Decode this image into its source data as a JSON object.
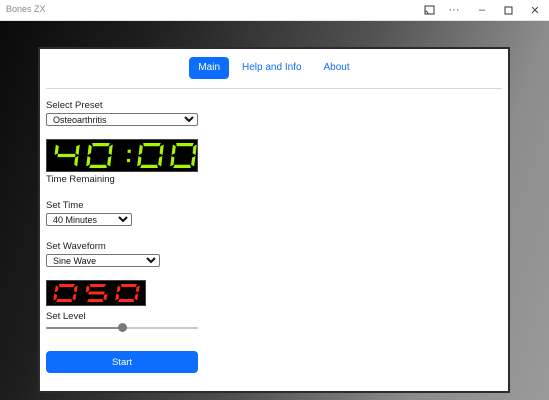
{
  "window": {
    "title": "Bones ZX",
    "controls": [
      "cast-icon",
      "more-icon",
      "minimize-icon",
      "maximize-icon",
      "close-icon"
    ]
  },
  "nav": {
    "items": [
      {
        "label": "Main",
        "active": true
      },
      {
        "label": "Help and Info",
        "active": false
      },
      {
        "label": "About",
        "active": false
      }
    ]
  },
  "preset": {
    "label": "Select Preset",
    "value": "Osteoarthritis"
  },
  "timer": {
    "display": "40:00",
    "caption": "Time Remaining",
    "color": "#a7f500"
  },
  "time": {
    "label": "Set Time",
    "value": "40 Minutes"
  },
  "waveform": {
    "label": "Set Waveform",
    "value": "Sine Wave"
  },
  "level": {
    "display": "050",
    "label": "Set Level",
    "value_percent": 50,
    "color": "#ff2a10"
  },
  "start": {
    "label": "Start"
  },
  "colors": {
    "accent": "#0d6efd"
  }
}
